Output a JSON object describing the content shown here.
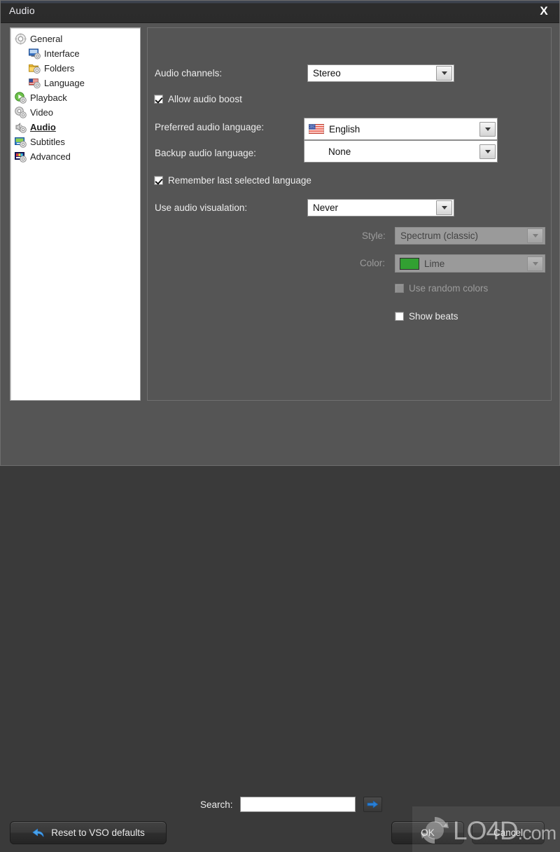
{
  "window": {
    "title": "Audio",
    "close_label": "X",
    "close_icon": "close-icon"
  },
  "sidebar": {
    "items": [
      {
        "label": "General",
        "icon": "gear-icon",
        "level": 0,
        "selected": false
      },
      {
        "label": "Interface",
        "icon": "interface-gear-icon",
        "level": 1,
        "selected": false
      },
      {
        "label": "Folders",
        "icon": "folder-gear-icon",
        "level": 1,
        "selected": false
      },
      {
        "label": "Language",
        "icon": "flag-gear-icon",
        "level": 1,
        "selected": false
      },
      {
        "label": "Playback",
        "icon": "play-gear-icon",
        "level": 0,
        "selected": false
      },
      {
        "label": "Video",
        "icon": "video-gear-icon",
        "level": 0,
        "selected": false
      },
      {
        "label": "Audio",
        "icon": "audio-gear-icon",
        "level": 0,
        "selected": true
      },
      {
        "label": "Subtitles",
        "icon": "subtitles-gear-icon",
        "level": 0,
        "selected": false
      },
      {
        "label": "Advanced",
        "icon": "advanced-gear-icon",
        "level": 0,
        "selected": false
      }
    ]
  },
  "panel": {
    "audio_channels": {
      "label": "Audio channels:",
      "value": "Stereo"
    },
    "allow_audio_boost": {
      "label": "Allow audio boost",
      "checked": true
    },
    "preferred_audio_language": {
      "label": "Preferred audio language:",
      "value": "English",
      "flag": "us-flag-icon"
    },
    "backup_audio_language": {
      "label": "Backup audio language:",
      "value": "None"
    },
    "remember_last_selected_language": {
      "label": "Remember last selected language",
      "checked": true
    },
    "use_audio_visualisation": {
      "label": "Use audio visualation:",
      "value": "Never"
    },
    "style": {
      "label": "Style:",
      "value": "Spectrum (classic)",
      "disabled": true
    },
    "color": {
      "label": "Color:",
      "value": "Lime",
      "swatch_hex": "#32a032",
      "disabled": true
    },
    "use_random_colors": {
      "label": "Use random colors",
      "checked": false,
      "disabled": true
    },
    "show_beats": {
      "label": "Show beats",
      "checked": false,
      "disabled": false
    }
  },
  "footer": {
    "search_label": "Search:",
    "search_value": "",
    "search_placeholder": "",
    "search_go_icon": "arrow-right-icon",
    "reset_label": "Reset to VSO defaults",
    "reset_icon": "undo-arrow-icon",
    "ok_label": "OK",
    "cancel_label": "Cancel"
  },
  "watermark": {
    "text": "LO4D",
    "suffix": ".com",
    "icon": "refresh-circle-icon"
  },
  "colors": {
    "panel_bg": "#555555",
    "titlebar_bg": "#2b2b2b",
    "sidebar_bg": "#ffffff",
    "accent_blue": "#2a7fd4",
    "lime": "#32a032"
  }
}
